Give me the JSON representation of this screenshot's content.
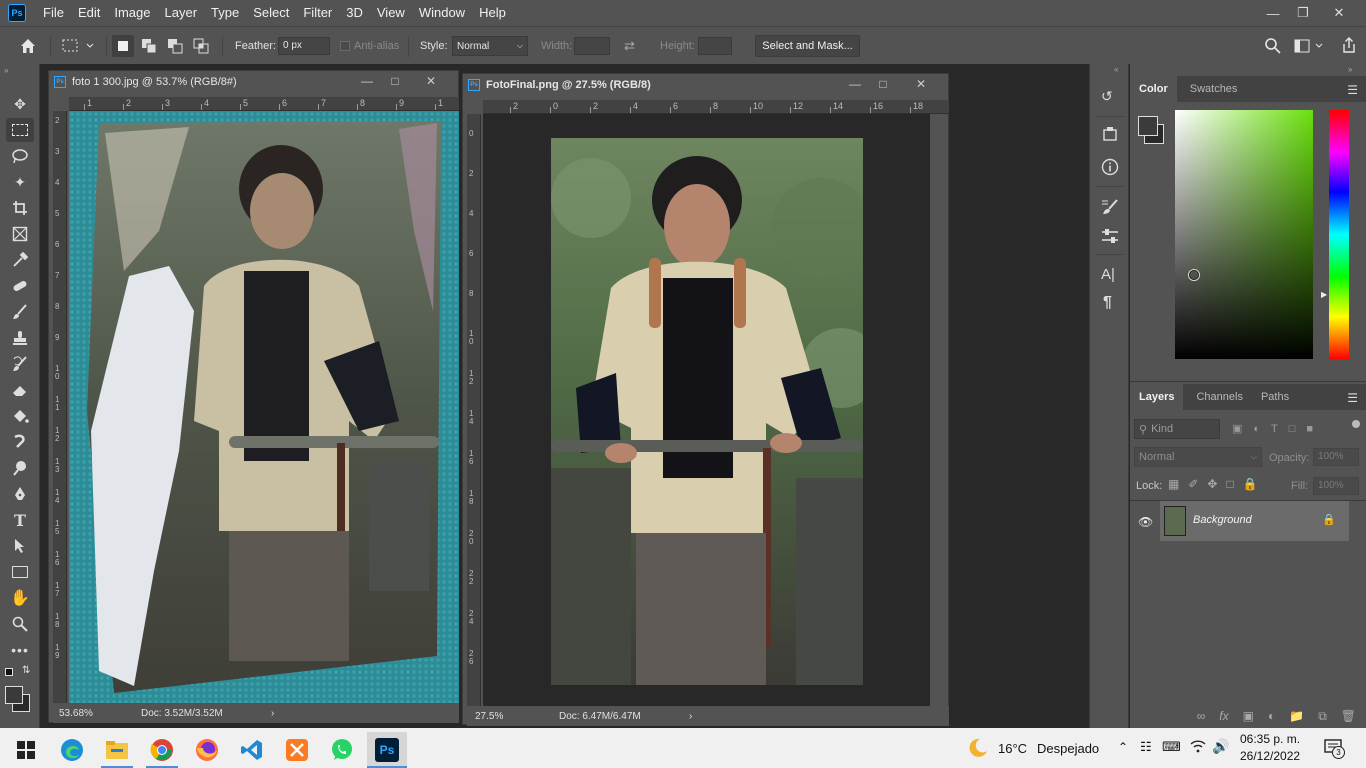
{
  "menubar": {
    "items": [
      "File",
      "Edit",
      "Image",
      "Layer",
      "Type",
      "Select",
      "Filter",
      "3D",
      "View",
      "Window",
      "Help"
    ],
    "ps_logo": "Ps"
  },
  "options": {
    "feather_label": "Feather:",
    "feather_value": "0 px",
    "antialias_label": "Anti-alias",
    "style_label": "Style:",
    "style_value": "Normal",
    "width_label": "Width:",
    "height_label": "Height:",
    "select_mask": "Select and Mask..."
  },
  "doc1": {
    "title": "foto 1 300.jpg @ 53.7% (RGB/8#)",
    "zoom": "53.68%",
    "doc_size": "Doc: 3.52M/3.52M",
    "ruler_h": [
      "1",
      "2",
      "3",
      "4",
      "5",
      "6",
      "7",
      "8",
      "9",
      "1"
    ],
    "ruler_v": [
      "2",
      "3",
      "4",
      "5",
      "6",
      "7",
      "8",
      "9",
      "1\n0",
      "1\n1",
      "1\n2",
      "1\n3",
      "1\n4",
      "1\n5",
      "1\n6",
      "1\n7",
      "1\n8",
      "1\n9"
    ]
  },
  "doc2": {
    "title": "FotoFinal.png @ 27.5% (RGB/8)",
    "zoom": "27.5%",
    "doc_size": "Doc: 6.47M/6.47M",
    "ruler_h": [
      "2",
      "0",
      "2",
      "4",
      "6",
      "8",
      "10",
      "12",
      "14",
      "16",
      "18"
    ],
    "ruler_v": [
      "0",
      "2",
      "4",
      "6",
      "8",
      "1\n0",
      "1\n2",
      "1\n4",
      "1\n6",
      "1\n8",
      "2\n0",
      "2\n2",
      "2\n4",
      "2\n6"
    ]
  },
  "color_panel": {
    "tabs": [
      "Color",
      "Swatches"
    ]
  },
  "layers_panel": {
    "tabs": [
      "Layers",
      "Channels",
      "Paths"
    ],
    "kind_placeholder": "Kind",
    "blend_mode": "Normal",
    "opacity_label": "Opacity:",
    "opacity_value": "100%",
    "lock_label": "Lock:",
    "fill_label": "Fill:",
    "fill_value": "100%",
    "layer_name": "Background"
  },
  "taskbar": {
    "weather_temp": "16°C",
    "weather_text": "Despejado",
    "time": "06:35 p. m.",
    "date": "26/12/2022",
    "notif_count": "3",
    "ps_label": "Ps"
  },
  "colors": {
    "ps_blue": "#31a8ff",
    "panel_bg": "#535353",
    "canvas_bg": "#282828"
  }
}
